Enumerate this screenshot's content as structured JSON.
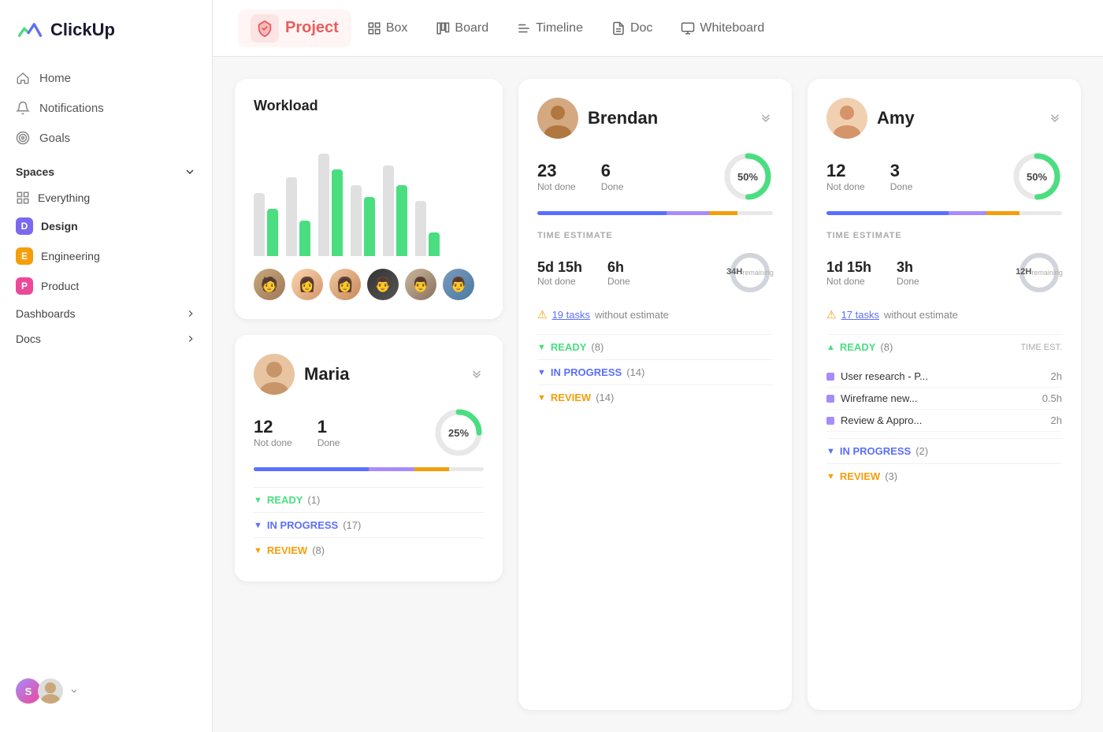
{
  "logo": {
    "text": "ClickUp"
  },
  "sidebar": {
    "nav": [
      {
        "id": "home",
        "label": "Home",
        "icon": "home"
      },
      {
        "id": "notifications",
        "label": "Notifications",
        "icon": "bell"
      },
      {
        "id": "goals",
        "label": "Goals",
        "icon": "trophy"
      }
    ],
    "spaces_label": "Spaces",
    "everything_label": "Everything",
    "spaces": [
      {
        "id": "design",
        "label": "Design",
        "badge": "D",
        "badge_class": "badge-d",
        "active": true
      },
      {
        "id": "engineering",
        "label": "Engineering",
        "badge": "E",
        "badge_class": "badge-e"
      },
      {
        "id": "product",
        "label": "Product",
        "badge": "P",
        "badge_class": "badge-p"
      }
    ],
    "dashboards_label": "Dashboards",
    "docs_label": "Docs",
    "bottom": {
      "avatar_s": "S"
    }
  },
  "topnav": {
    "active": "Project",
    "items": [
      {
        "id": "box",
        "label": "Box",
        "icon": "grid"
      },
      {
        "id": "board",
        "label": "Board",
        "icon": "board"
      },
      {
        "id": "timeline",
        "label": "Timeline",
        "icon": "timeline"
      },
      {
        "id": "doc",
        "label": "Doc",
        "icon": "doc"
      },
      {
        "id": "whiteboard",
        "label": "Whiteboard",
        "icon": "whiteboard"
      }
    ]
  },
  "workload": {
    "title": "Workload",
    "bars": [
      {
        "gray": 80,
        "green": 60
      },
      {
        "gray": 100,
        "green": 45
      },
      {
        "gray": 130,
        "green": 110
      },
      {
        "gray": 90,
        "green": 75
      },
      {
        "gray": 115,
        "green": 90
      },
      {
        "gray": 70,
        "green": 30
      }
    ]
  },
  "brendan": {
    "name": "Brendan",
    "not_done": 23,
    "not_done_label": "Not done",
    "done": 6,
    "done_label": "Done",
    "percent": "50%",
    "percent_val": 50,
    "time_estimate_label": "TIME ESTIMATE",
    "te_not_done": "5d 15h",
    "te_not_done_label": "Not done",
    "te_done": "6h",
    "te_done_label": "Done",
    "te_total": "34H",
    "te_total_sub": "remaining",
    "warning": "19 tasks",
    "warning_suffix": "without estimate",
    "sections": [
      {
        "status": "ready",
        "label": "READY",
        "count": "(8)"
      },
      {
        "status": "inprogress",
        "label": "IN PROGRESS",
        "count": "(14)"
      },
      {
        "status": "review",
        "label": "REVIEW",
        "count": "(14)"
      }
    ]
  },
  "amy": {
    "name": "Amy",
    "not_done": 12,
    "not_done_label": "Not done",
    "done": 3,
    "done_label": "Done",
    "percent": "50%",
    "percent_val": 50,
    "time_estimate_label": "TIME ESTIMATE",
    "te_not_done": "1d 15h",
    "te_not_done_label": "Not done",
    "te_done": "3h",
    "te_done_label": "Done",
    "te_total": "12H",
    "te_total_sub": "remaining",
    "warning": "17 tasks",
    "warning_suffix": "without estimate",
    "sections": [
      {
        "status": "ready",
        "label": "READY",
        "count": "(8)",
        "show_time_est": true
      },
      {
        "status": "inprogress",
        "label": "IN PROGRESS",
        "count": "(2)"
      },
      {
        "status": "review",
        "label": "REVIEW",
        "count": "(3)"
      }
    ],
    "tasks": [
      {
        "label": "User research - P...",
        "time": "2h"
      },
      {
        "label": "Wireframe new...",
        "time": "0.5h"
      },
      {
        "label": "Review & Appro...",
        "time": "2h"
      }
    ]
  },
  "maria": {
    "name": "Maria",
    "not_done": 12,
    "not_done_label": "Not done",
    "done": 1,
    "done_label": "Done",
    "percent": "25%",
    "percent_val": 25,
    "sections": [
      {
        "status": "ready",
        "label": "READY",
        "count": "(1)"
      },
      {
        "status": "inprogress",
        "label": "IN PROGRESS",
        "count": "(17)"
      },
      {
        "status": "review",
        "label": "REVIEW",
        "count": "(8)"
      }
    ]
  }
}
